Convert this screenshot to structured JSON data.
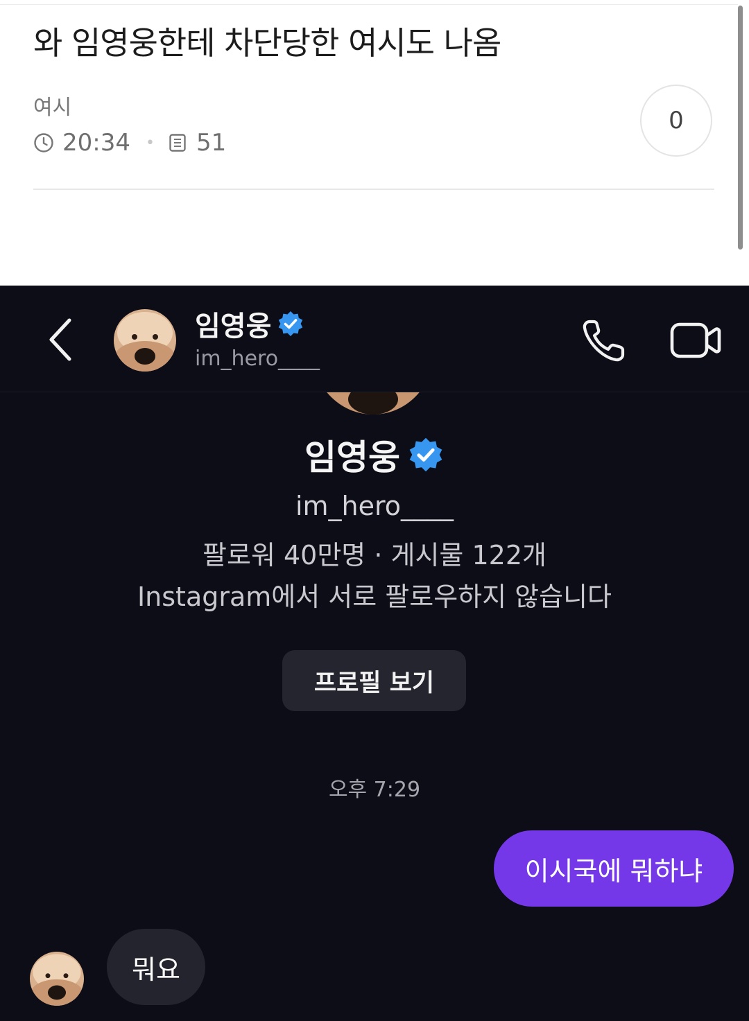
{
  "post": {
    "title": "와 임영웅한테 차단당한 여시도 나옴",
    "author": "여시",
    "time": "20:34",
    "views": "51",
    "comment_count": "0",
    "icons": {
      "time": "clock-icon",
      "views": "document-icon"
    }
  },
  "dm": {
    "header": {
      "name": "임영웅",
      "username": "im_hero____",
      "icons": [
        "back-chevron-icon",
        "verified-badge-icon",
        "phone-icon",
        "video-camera-icon"
      ]
    },
    "profile": {
      "name": "임영웅",
      "username": "im_hero____",
      "stats": "팔로워 40만명 · 게시물 122개",
      "follow_note": "Instagram에서 서로 팔로우하지 않습니다",
      "view_profile_label": "프로필 보기"
    },
    "messages": {
      "time": "오후 7:29",
      "outgoing": "이시국에 뭐하냐",
      "incoming": "뭐요"
    }
  },
  "colors": {
    "dm_background": "#0d0d17",
    "outgoing_bubble": "#7438e8",
    "incoming_bubble": "#24242e",
    "verified_badge": "#3797f0"
  }
}
